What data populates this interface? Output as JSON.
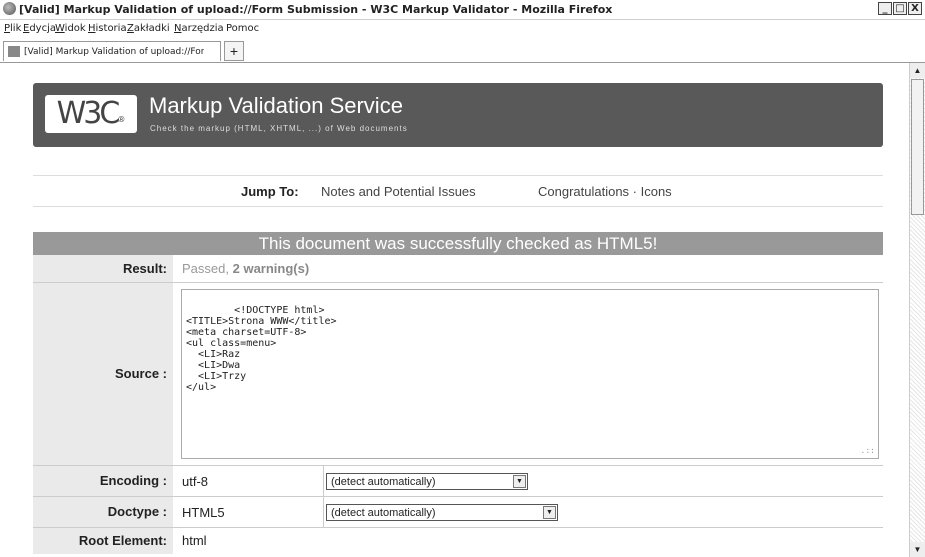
{
  "window": {
    "title": "[Valid] Markup Validation of upload://Form Submission - W3C Markup Validator - Mozilla Firefox",
    "controls": {
      "minimize": "_",
      "maximize": "□",
      "close": "X"
    }
  },
  "menu": {
    "items": [
      {
        "accel": "P",
        "rest": "lik"
      },
      {
        "accel": "E",
        "rest": "dycja"
      },
      {
        "accel": "W",
        "rest": "idok"
      },
      {
        "accel": "H",
        "rest": "istoria"
      },
      {
        "accel": "Z",
        "rest": "akładki"
      },
      {
        "accel": "N",
        "rest": "arzędzia"
      },
      {
        "accel": "",
        "rest": "Pomoc"
      }
    ]
  },
  "tabs": {
    "active_label": "[Valid] Markup Validation of upload://Form S...",
    "close": "×",
    "new_tab": "+"
  },
  "banner": {
    "logo": "W3C",
    "logo_mark": "®",
    "title": "Markup Validation Service",
    "subtitle": "Check the markup (HTML, XHTML, ...) of Web documents"
  },
  "jump": {
    "label": "Jump To:",
    "link1": "Notes and Potential Issues",
    "link2": "Congratulations · Icons"
  },
  "results": {
    "header": "This document was successfully checked as HTML5!",
    "result_label": "Result:",
    "result_passed": "Passed,",
    "result_warnings": "2 warning(s)",
    "source_label": "Source :",
    "source_code": "<!DOCTYPE html>\n<TITLE>Strona WWW</title>\n<meta charset=UTF-8>\n<ul class=menu>\n  <LI>Raz\n  <LI>Dwa\n  <LI>Trzy\n</ul>",
    "encoding_label": "Encoding :",
    "encoding_value": "utf-8",
    "encoding_select": "(detect automatically)",
    "doctype_label": "Doctype :",
    "doctype_value": "HTML5",
    "doctype_select": "(detect automatically)",
    "root_label": "Root Element:",
    "root_value": "html"
  },
  "colors": {
    "banner_bg": "#595959",
    "header_bg": "#999999",
    "label_bg": "#eaeaea"
  }
}
